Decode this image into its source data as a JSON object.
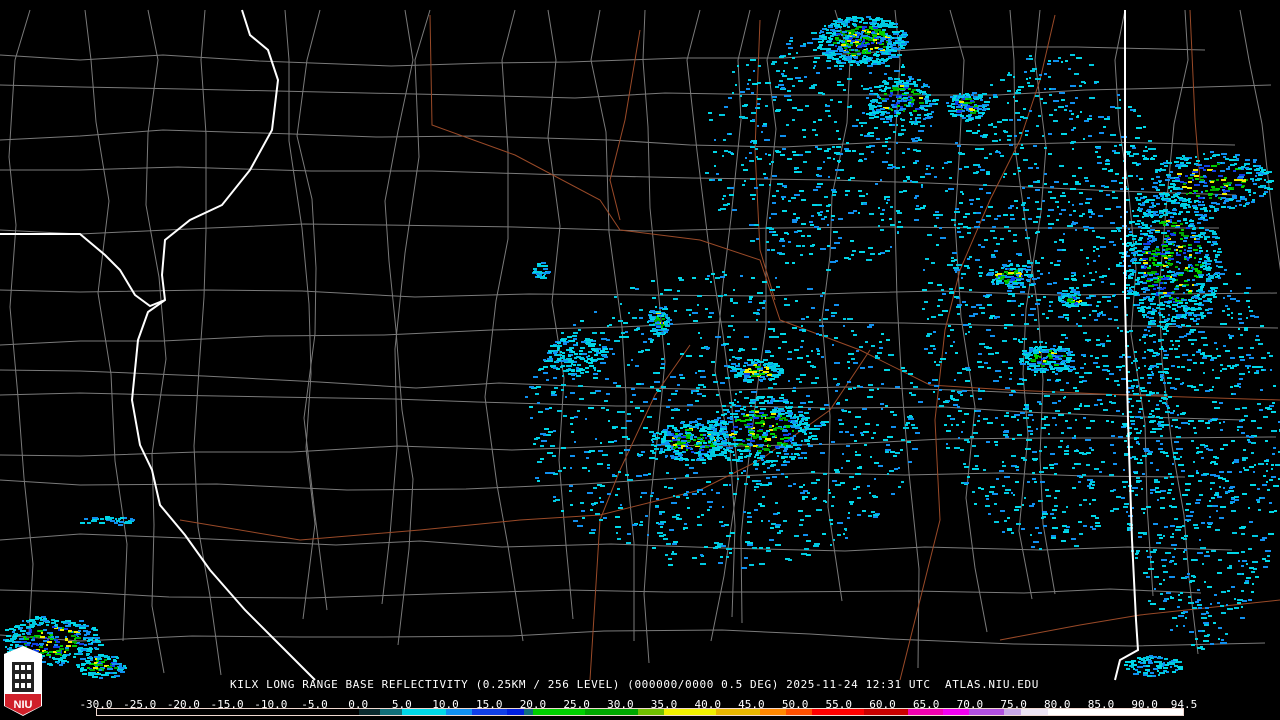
{
  "product": {
    "title": "KILX LONG RANGE BASE REFLECTIVITY (0.25KM / 256 LEVEL) (000000/0000 0.5 DEG) 2025-11-24 12:31 UTC  ATLAS.NIU.EDU",
    "logo_text": "NIU"
  },
  "colorbar": {
    "min": -30.0,
    "max": 94.5,
    "tick_labels": [
      "-30.0",
      "-25.0",
      "-20.0",
      "-15.0",
      "-10.0",
      "-5.0",
      "0.0",
      "5.0",
      "10.0",
      "15.0",
      "20.0",
      "25.0",
      "30.0",
      "35.0",
      "40.0",
      "45.0",
      "50.0",
      "55.0",
      "60.0",
      "65.0",
      "70.0",
      "75.0",
      "80.0",
      "85.0",
      "90.0",
      "94.5"
    ],
    "segments": [
      {
        "from": -30,
        "to": 0,
        "color": "#000000"
      },
      {
        "from": 0,
        "to": 2.5,
        "color": "#0b2a2e"
      },
      {
        "from": 2.5,
        "to": 5,
        "color": "#12707a"
      },
      {
        "from": 5,
        "to": 10,
        "color": "#00d8e8"
      },
      {
        "from": 10,
        "to": 13,
        "color": "#1090f0"
      },
      {
        "from": 13,
        "to": 17,
        "color": "#1040e8"
      },
      {
        "from": 17,
        "to": 19,
        "color": "#0020e0"
      },
      {
        "from": 19,
        "to": 20,
        "color": "#107080"
      },
      {
        "from": 20,
        "to": 26,
        "color": "#00d000"
      },
      {
        "from": 26,
        "to": 32,
        "color": "#00a800"
      },
      {
        "from": 32,
        "to": 35,
        "color": "#70c000"
      },
      {
        "from": 35,
        "to": 41,
        "color": "#f0f000"
      },
      {
        "from": 41,
        "to": 46,
        "color": "#e8b800"
      },
      {
        "from": 46,
        "to": 49,
        "color": "#ff8800"
      },
      {
        "from": 49,
        "to": 52,
        "color": "#ff5000"
      },
      {
        "from": 52,
        "to": 58,
        "color": "#ff0000"
      },
      {
        "from": 58,
        "to": 63,
        "color": "#c80000"
      },
      {
        "from": 63,
        "to": 67,
        "color": "#f000b0"
      },
      {
        "from": 67,
        "to": 70,
        "color": "#f000f0"
      },
      {
        "from": 70,
        "to": 74,
        "color": "#b050e0"
      },
      {
        "from": 74,
        "to": 76,
        "color": "#c8a8e8"
      },
      {
        "from": 76,
        "to": 79,
        "color": "#ece4f4"
      },
      {
        "from": 79,
        "to": 94.5,
        "color": "#ffffff"
      }
    ]
  },
  "colors": {
    "county": "#808080",
    "state": "#ffffff",
    "road": "#a0522d"
  }
}
